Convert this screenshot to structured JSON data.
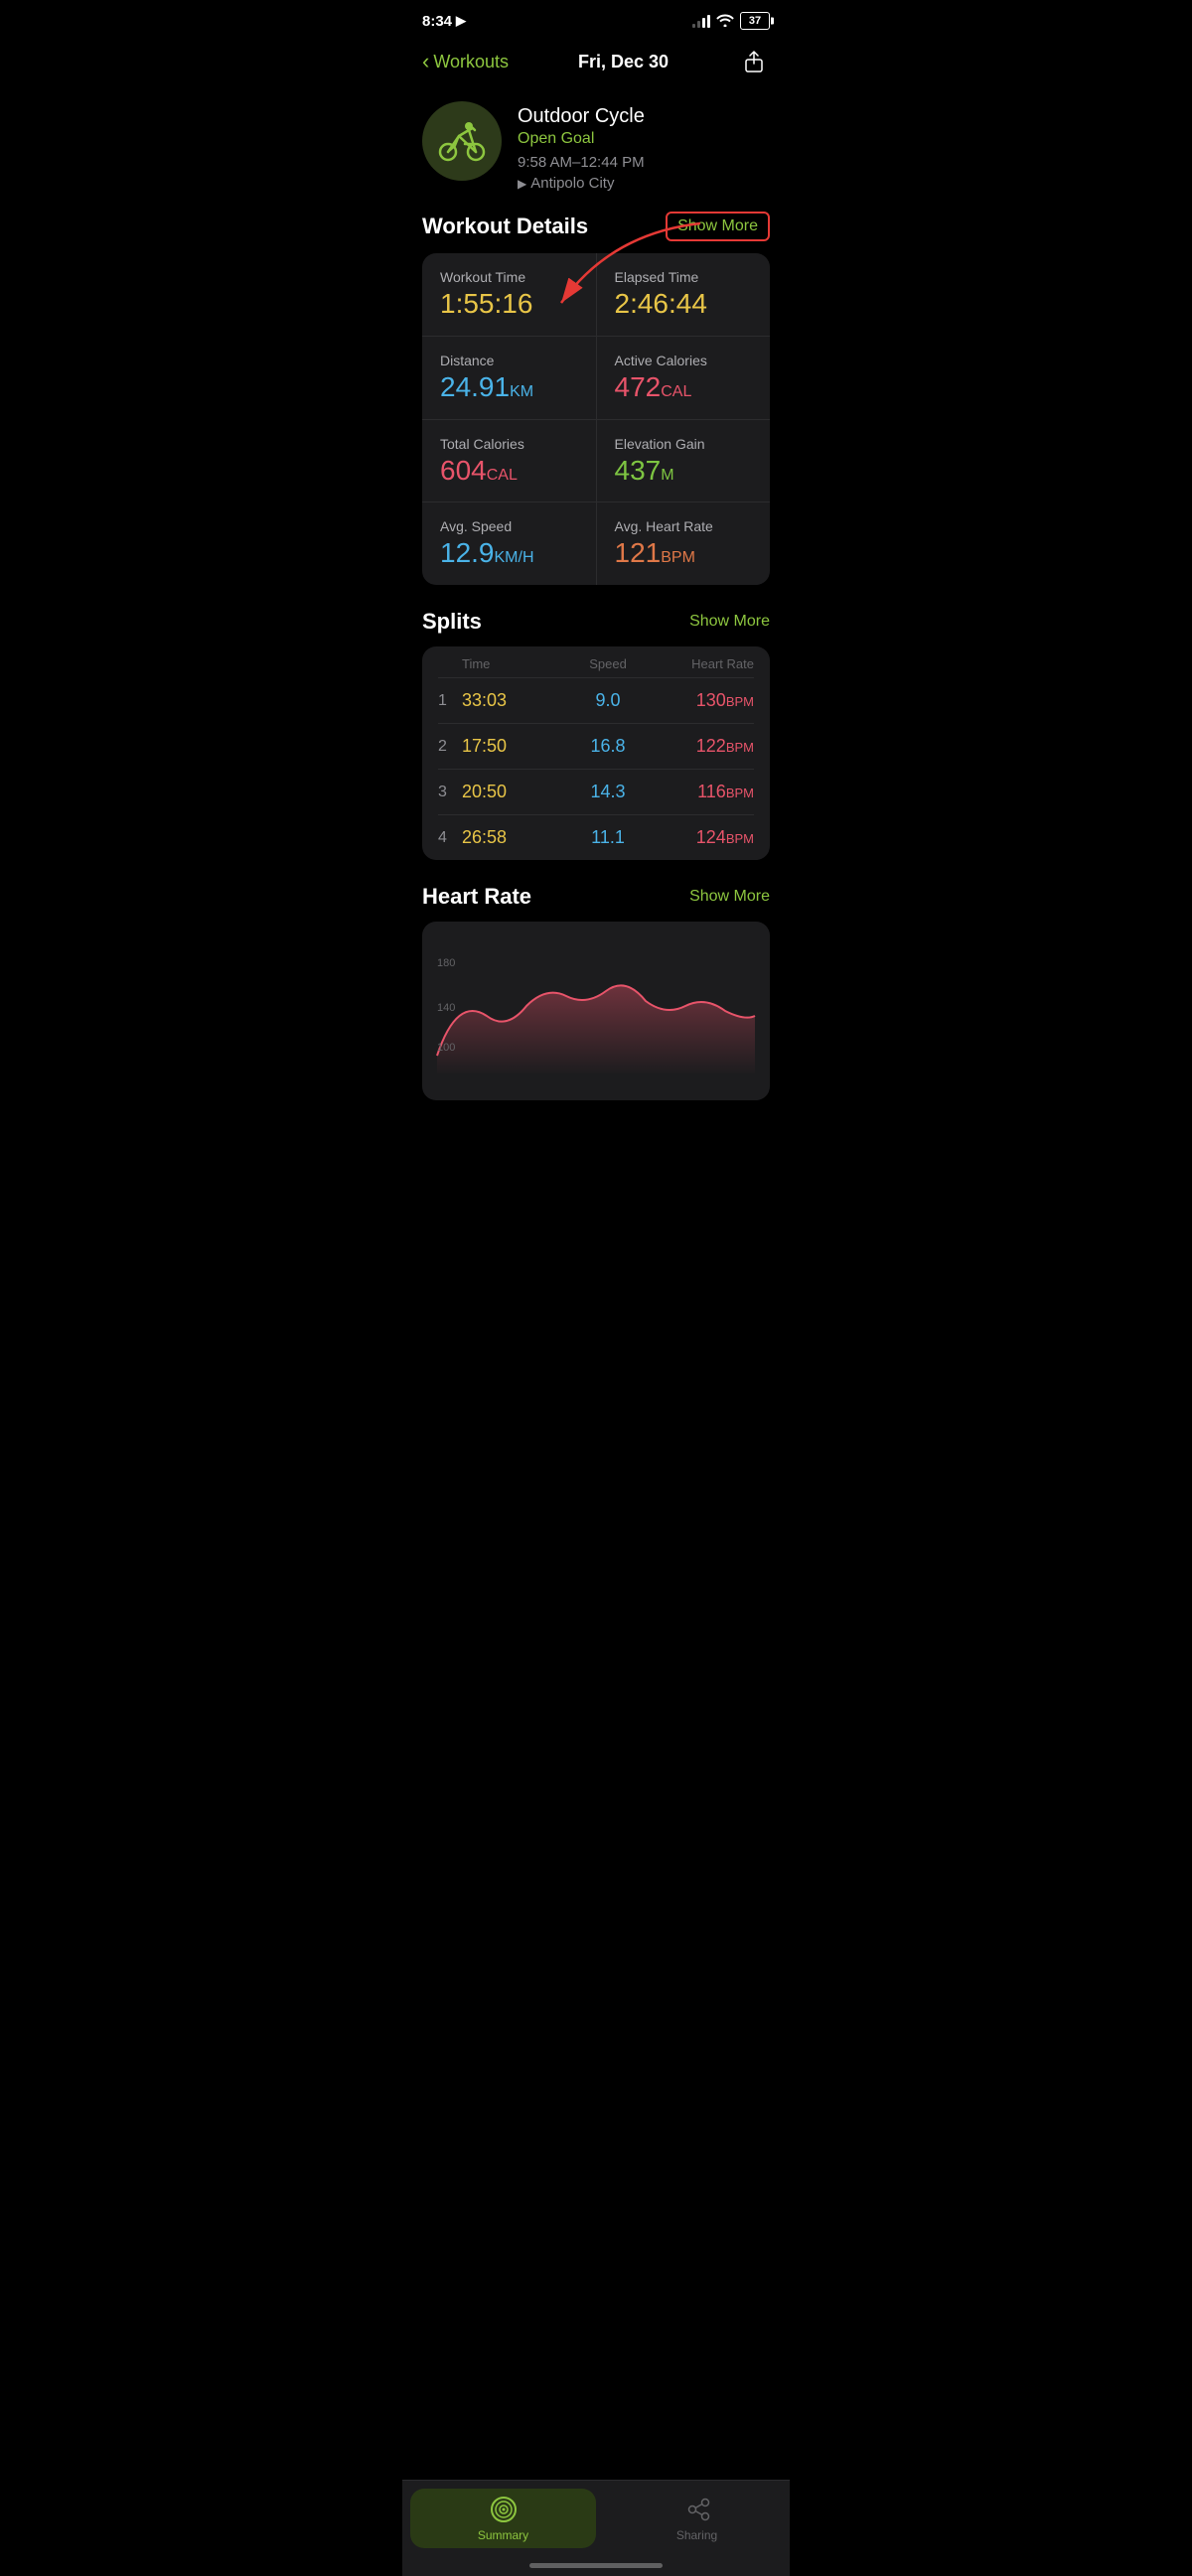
{
  "statusBar": {
    "time": "8:34",
    "battery": "37"
  },
  "nav": {
    "backLabel": "Workouts",
    "title": "Fri, Dec 30"
  },
  "workoutHeader": {
    "type": "Outdoor Cycle",
    "goal": "Open Goal",
    "timeRange": "9:58 AM–12:44 PM",
    "location": "Antipolo City"
  },
  "workoutDetails": {
    "sectionTitle": "Workout Details",
    "showMoreLabel": "Show More",
    "stats": [
      {
        "label": "Workout Time",
        "value": "1:55:16",
        "unit": "",
        "colorClass": "color-yellow"
      },
      {
        "label": "Elapsed Time",
        "value": "2:46:44",
        "unit": "",
        "colorClass": "color-yellow"
      },
      {
        "label": "Distance",
        "value": "24.91",
        "unit": "KM",
        "colorClass": "color-blue"
      },
      {
        "label": "Active Calories",
        "value": "472",
        "unit": "CAL",
        "colorClass": "color-pink"
      },
      {
        "label": "Total Calories",
        "value": "604",
        "unit": "CAL",
        "colorClass": "color-pink"
      },
      {
        "label": "Elevation Gain",
        "value": "437",
        "unit": "M",
        "colorClass": "color-green"
      },
      {
        "label": "Avg. Speed",
        "value": "12.9",
        "unit": "KM/H",
        "colorClass": "color-blue"
      },
      {
        "label": "Avg. Heart Rate",
        "value": "121",
        "unit": "BPM",
        "colorClass": "color-orange"
      }
    ]
  },
  "splits": {
    "sectionTitle": "Splits",
    "showMoreLabel": "Show More",
    "headers": {
      "num": "",
      "time": "Time",
      "speed": "Speed",
      "heartRate": "Heart Rate"
    },
    "rows": [
      {
        "num": "1",
        "time": "33:03",
        "speed": "9.0",
        "hr": "130"
      },
      {
        "num": "2",
        "time": "17:50",
        "speed": "16.8",
        "hr": "122"
      },
      {
        "num": "3",
        "time": "20:50",
        "speed": "14.3",
        "hr": "116"
      },
      {
        "num": "4",
        "time": "26:58",
        "speed": "11.1",
        "hr": "124"
      }
    ]
  },
  "heartRate": {
    "sectionTitle": "Heart Rate",
    "showMoreLabel": "Show More"
  },
  "tabBar": {
    "tabs": [
      {
        "id": "summary",
        "label": "Summary",
        "active": true
      },
      {
        "id": "sharing",
        "label": "Sharing",
        "active": false
      }
    ]
  }
}
